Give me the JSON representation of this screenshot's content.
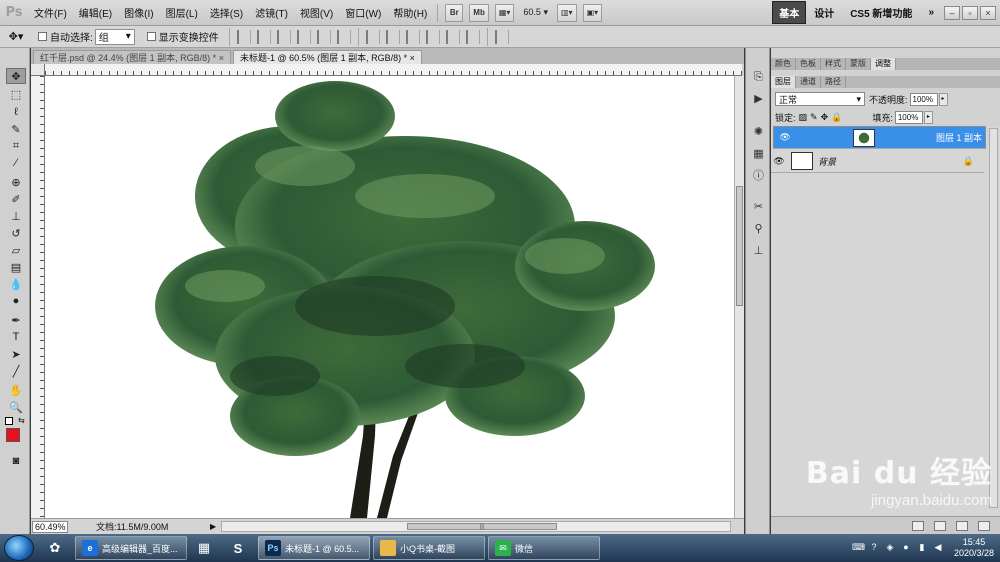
{
  "app": {
    "logo": "Ps"
  },
  "menu": [
    "文件(F)",
    "编辑(E)",
    "图像(I)",
    "图层(L)",
    "选择(S)",
    "滤镜(T)",
    "视图(V)",
    "窗口(W)",
    "帮助(H)"
  ],
  "menubar": {
    "bridge": "Br",
    "minibridge": "Mb",
    "zoom": "60.5",
    "workspace_active": "基本",
    "workspace_2": "设计",
    "workspace_3": "CS5 新增功能",
    "more": "»"
  },
  "options": {
    "auto_select_label": "自动选择:",
    "auto_select_value": "组",
    "show_transform_label": "显示变换控件"
  },
  "tabs": [
    {
      "label": "红千层.psd @ 24.4% (图层 1 副本, RGB/8) *",
      "close": "×"
    },
    {
      "label": "未标题-1 @ 60.5% (图层 1 副本, RGB/8) *",
      "close": "×"
    }
  ],
  "status": {
    "zoom": "60.49%",
    "doc": "文档:11.5M/9.00M",
    "arrow": "▶"
  },
  "panels": {
    "top_tabs": [
      "颜色",
      "色板",
      "样式",
      "蒙版",
      "调整"
    ],
    "layer_tabs": [
      "图层",
      "通道",
      "路径"
    ],
    "blend_mode": "正常",
    "opacity_label": "不透明度:",
    "opacity": "100%",
    "lock_label": "锁定:",
    "fill_label": "填充:",
    "fill": "100%",
    "layers": [
      {
        "name": "图层 1 副本",
        "selected": true
      },
      {
        "name": "背景",
        "selected": false
      }
    ]
  },
  "watermark": {
    "brand": "Bai du 经验",
    "url": "jingyan.baidu.com"
  },
  "taskbar": {
    "tasks": [
      {
        "label": "高级编辑器_百度...",
        "icon_color": "#1b6fd6"
      },
      {
        "label": "未标题-1 @ 60.5...",
        "icon_color": "#0a2a4f",
        "icon_text": "Ps"
      },
      {
        "label": "小Q书桌-截图",
        "icon_color": "#e8b84a"
      },
      {
        "label": "微信",
        "icon_color": "#2bb24c"
      }
    ],
    "time": "15:45",
    "date": "2020/3/28"
  },
  "colors": {
    "foreground": "#e3121b",
    "selection": "#3a8fe8"
  }
}
